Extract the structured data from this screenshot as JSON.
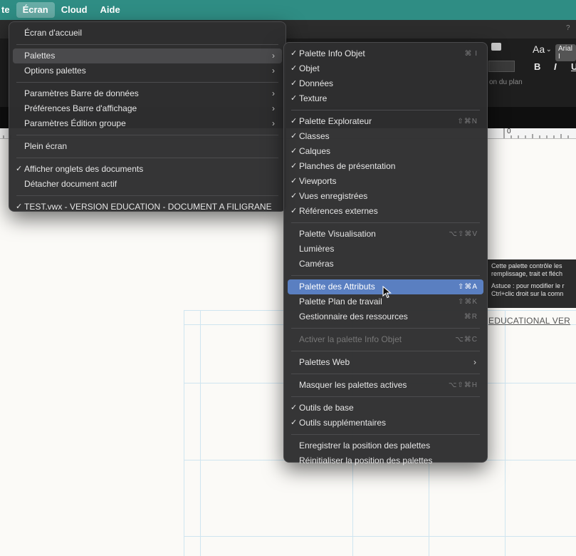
{
  "menubar": {
    "items": [
      {
        "label": "te"
      },
      {
        "label": "Écran"
      },
      {
        "label": "Cloud"
      },
      {
        "label": "Aide"
      }
    ]
  },
  "toolbar": {
    "aa_label": "Aa",
    "font_badge": "Arial I",
    "bold": "B",
    "italic": "I",
    "underline": "U",
    "plan_text": "on du plan",
    "help_icon": "?"
  },
  "ruler": {
    "label": "0"
  },
  "watermark": "EDUCATIONAL VER",
  "tooltip": {
    "lines": [
      "Cette palette contrôle les",
      "remplissage, trait et fléch",
      "",
      "Astuce : pour modifier le r",
      "Ctrl+clic droit sur la comn"
    ]
  },
  "menu_ecran": {
    "items": [
      {
        "label": "Écran d'accueil",
        "type": "item"
      },
      {
        "type": "sep"
      },
      {
        "label": "Palettes",
        "type": "item",
        "submenu": true,
        "hovered": true
      },
      {
        "label": "Options palettes",
        "type": "item",
        "submenu": true
      },
      {
        "type": "sep"
      },
      {
        "label": "Paramètres Barre de données",
        "type": "item",
        "submenu": true
      },
      {
        "label": "Préférences Barre d'affichage",
        "type": "item",
        "submenu": true
      },
      {
        "label": "Paramètres Édition groupe",
        "type": "item",
        "submenu": true
      },
      {
        "type": "sep"
      },
      {
        "label": "Plein écran",
        "type": "item"
      },
      {
        "type": "sep"
      },
      {
        "label": "Afficher onglets des documents",
        "type": "item",
        "checked": true
      },
      {
        "label": "Détacher document actif",
        "type": "item"
      },
      {
        "type": "sep"
      },
      {
        "label": "TEST.vwx - VERSION EDUCATION - DOCUMENT A FILIGRANE",
        "type": "item",
        "checked": true
      }
    ]
  },
  "menu_palettes": {
    "items": [
      {
        "label": "Palette Info Objet",
        "checked": true,
        "shortcut": "⌘ I",
        "type": "item"
      },
      {
        "label": "Objet",
        "checked": true,
        "type": "item"
      },
      {
        "label": "Données",
        "checked": true,
        "type": "item"
      },
      {
        "label": "Texture",
        "checked": true,
        "type": "item"
      },
      {
        "type": "sep"
      },
      {
        "label": "Palette Explorateur",
        "checked": true,
        "shortcut": "⇧⌘N",
        "type": "item"
      },
      {
        "label": "Classes",
        "checked": true,
        "type": "item"
      },
      {
        "label": "Calques",
        "checked": true,
        "type": "item"
      },
      {
        "label": "Planches de présentation",
        "checked": true,
        "type": "item"
      },
      {
        "label": "Viewports",
        "checked": true,
        "type": "item"
      },
      {
        "label": "Vues enregistrées",
        "checked": true,
        "type": "item"
      },
      {
        "label": "Références externes",
        "checked": true,
        "type": "item"
      },
      {
        "type": "sep"
      },
      {
        "label": "Palette Visualisation",
        "shortcut": "⌥⇧⌘V",
        "type": "item"
      },
      {
        "label": "Lumières",
        "type": "item"
      },
      {
        "label": "Caméras",
        "type": "item"
      },
      {
        "type": "sep"
      },
      {
        "label": "Palette des Attributs",
        "shortcut": "⇧⌘A",
        "type": "item",
        "highlight": true
      },
      {
        "label": "Palette Plan de travail",
        "shortcut": "⇧⌘K",
        "type": "item"
      },
      {
        "label": "Gestionnaire des ressources",
        "shortcut": "⌘R",
        "type": "item"
      },
      {
        "type": "sep"
      },
      {
        "label": "Activer la palette Info Objet",
        "shortcut": "⌥⌘C",
        "type": "item",
        "disabled": true
      },
      {
        "type": "sep"
      },
      {
        "label": "Palettes Web",
        "type": "item",
        "submenu": true
      },
      {
        "type": "sep"
      },
      {
        "label": "Masquer les palettes actives",
        "shortcut": "⌥⇧⌘H",
        "type": "item"
      },
      {
        "type": "sep"
      },
      {
        "label": "Outils de base",
        "checked": true,
        "type": "item"
      },
      {
        "label": "Outils supplémentaires",
        "checked": true,
        "type": "item"
      },
      {
        "type": "sep"
      },
      {
        "label": "Enregistrer la position des palettes",
        "type": "item"
      },
      {
        "label": "Réinitialiser la position des palettes",
        "type": "item"
      }
    ]
  },
  "icons": {
    "check": "✓",
    "submenu_arrow": "›"
  }
}
